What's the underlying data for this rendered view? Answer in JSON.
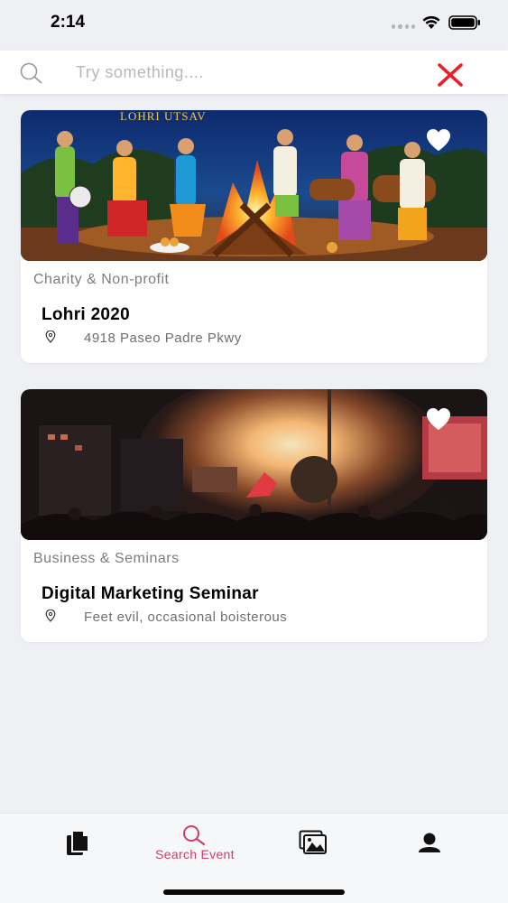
{
  "status_bar": {
    "time": "2:14"
  },
  "search": {
    "placeholder": "Try something....",
    "value": ""
  },
  "events": [
    {
      "category": "Charity & Non-profit",
      "title": "Lohri 2020",
      "location": "4918 Paseo Padre Pkwy",
      "banner_text": "LOHRI UTSAV",
      "favorited": false
    },
    {
      "category": "Business & Seminars",
      "title": "Digital Marketing Seminar",
      "location": "Feet evil, occasional boisterous",
      "favorited": false
    }
  ],
  "tab_bar": {
    "tabs": [
      {
        "icon": "documents-icon",
        "label": ""
      },
      {
        "icon": "search-icon",
        "label": "Search Event",
        "active": true
      },
      {
        "icon": "gallery-icon",
        "label": ""
      },
      {
        "icon": "profile-icon",
        "label": ""
      }
    ]
  },
  "colors": {
    "accent": "#cc3f6b",
    "clear": "#e8202a",
    "background": "#eff0f4"
  }
}
